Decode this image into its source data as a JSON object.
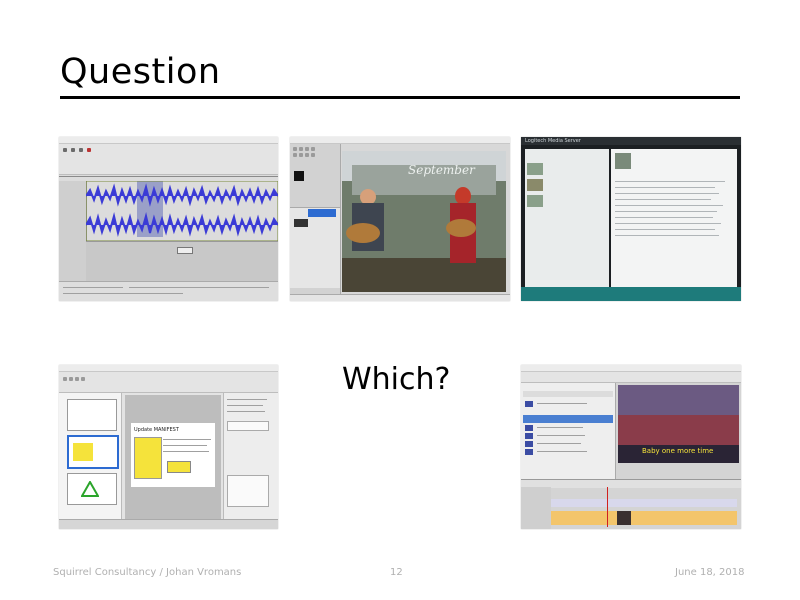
{
  "slide": {
    "title": "Question",
    "center_text": "Which?"
  },
  "footer": {
    "left": "Squirrel Consultancy / Johan Vromans",
    "page": "12",
    "date": "June 18, 2018"
  },
  "screenshots": [
    {
      "name": "audio-editor"
    },
    {
      "name": "image-editor",
      "banner_text": "September"
    },
    {
      "name": "media-server",
      "window_title": "Logitech Media Server"
    },
    {
      "name": "presentation-editor",
      "slide_heading": "Update MANIFEST"
    },
    {
      "name": "video-editor",
      "overlay_text": "Baby one more time"
    }
  ],
  "colors": {
    "waveform": "#3b3bd6",
    "selection": "#9aa0c8",
    "media_bg": "#1b1f22",
    "teal": "#1e7b7b",
    "yellow": "#f5e33b",
    "timeline_clip": "#f3c56b"
  }
}
